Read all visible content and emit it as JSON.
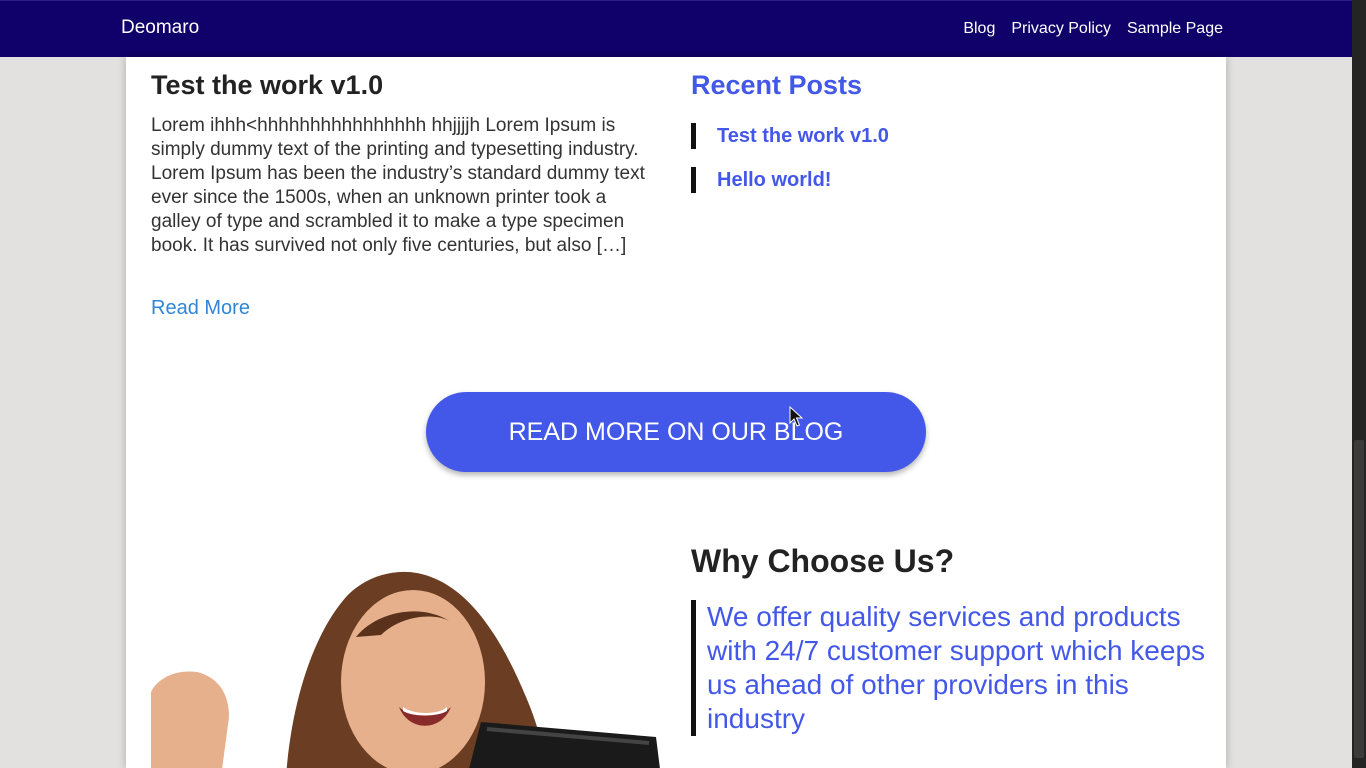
{
  "header": {
    "brand": "Deomaro",
    "nav": [
      "Blog",
      "Privacy Policy",
      "Sample Page"
    ]
  },
  "post": {
    "title": "Test the work v1.0",
    "excerpt": "Lorem ihhh<hhhhhhhhhhhhhhhh hhjjjjh Lorem Ipsum is simply dummy text of the printing and typesetting industry. Lorem Ipsum has been the industry’s standard dummy text ever since the 1500s, when an unknown printer took a galley of type and scrambled it to make a type specimen book. It has survived not only five centuries, but also […]",
    "read_more": "Read More"
  },
  "recent": {
    "heading": "Recent Posts",
    "items": [
      "Test the work v1.0",
      "Hello world!"
    ]
  },
  "cta": {
    "label": "READ MORE ON OUR BLOG"
  },
  "why": {
    "heading": "Why Choose Us?",
    "quote": "We offer quality services and products with 24/7 customer support which keeps us ahead of other providers in this industry"
  },
  "colors": {
    "topbar": "#10006a",
    "accent": "#4358e8",
    "link": "#2f86d6",
    "page_bg": "#e2e1df"
  },
  "icons": {
    "cursor": "mouse-pointer-icon"
  }
}
